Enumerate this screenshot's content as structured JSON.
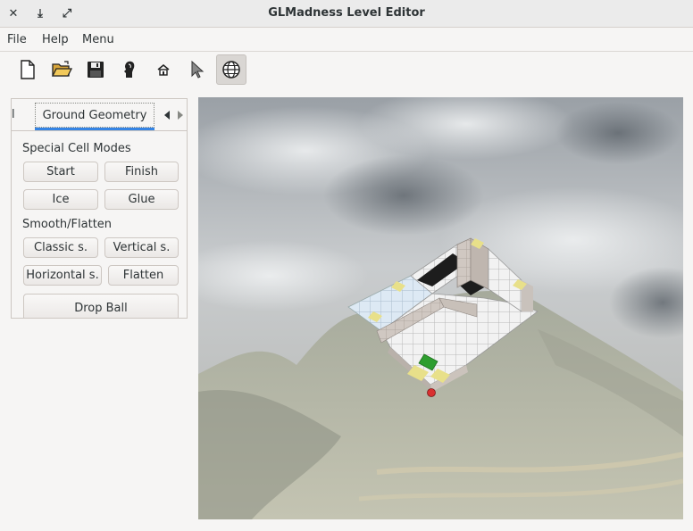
{
  "window": {
    "title": "GLMadness Level Editor",
    "close_glyph": "✕",
    "minimize_glyph": "⤓",
    "maximize_glyph": "⤢"
  },
  "menu": {
    "items": [
      "File",
      "Help",
      "Menu"
    ]
  },
  "toolbar": {
    "tools": [
      {
        "icon": "new-file-icon"
      },
      {
        "icon": "open-folder-icon"
      },
      {
        "icon": "save-disk-icon"
      },
      {
        "icon": "head-profile-icon"
      },
      {
        "icon": "home-icon"
      },
      {
        "icon": "pointer-arrow-icon"
      },
      {
        "icon": "globe-icon",
        "active": true
      }
    ]
  },
  "panel": {
    "clipped_tab": "l",
    "active_tab": "Ground Geometry",
    "sections": {
      "special": {
        "label": "Special Cell Modes",
        "buttons": [
          "Start",
          "Finish",
          "Ice",
          "Glue"
        ]
      },
      "smooth": {
        "label": "Smooth/Flatten",
        "buttons": [
          "Classic s.",
          "Vertical s.",
          "Horizontal s.",
          "Flatten"
        ]
      }
    },
    "drop_ball": "Drop Ball"
  },
  "colors": {
    "accent": "#3584e4",
    "start_cell": "#2e9e2e",
    "ball": "#d93030",
    "sticky_cell": "#e8e08a"
  }
}
